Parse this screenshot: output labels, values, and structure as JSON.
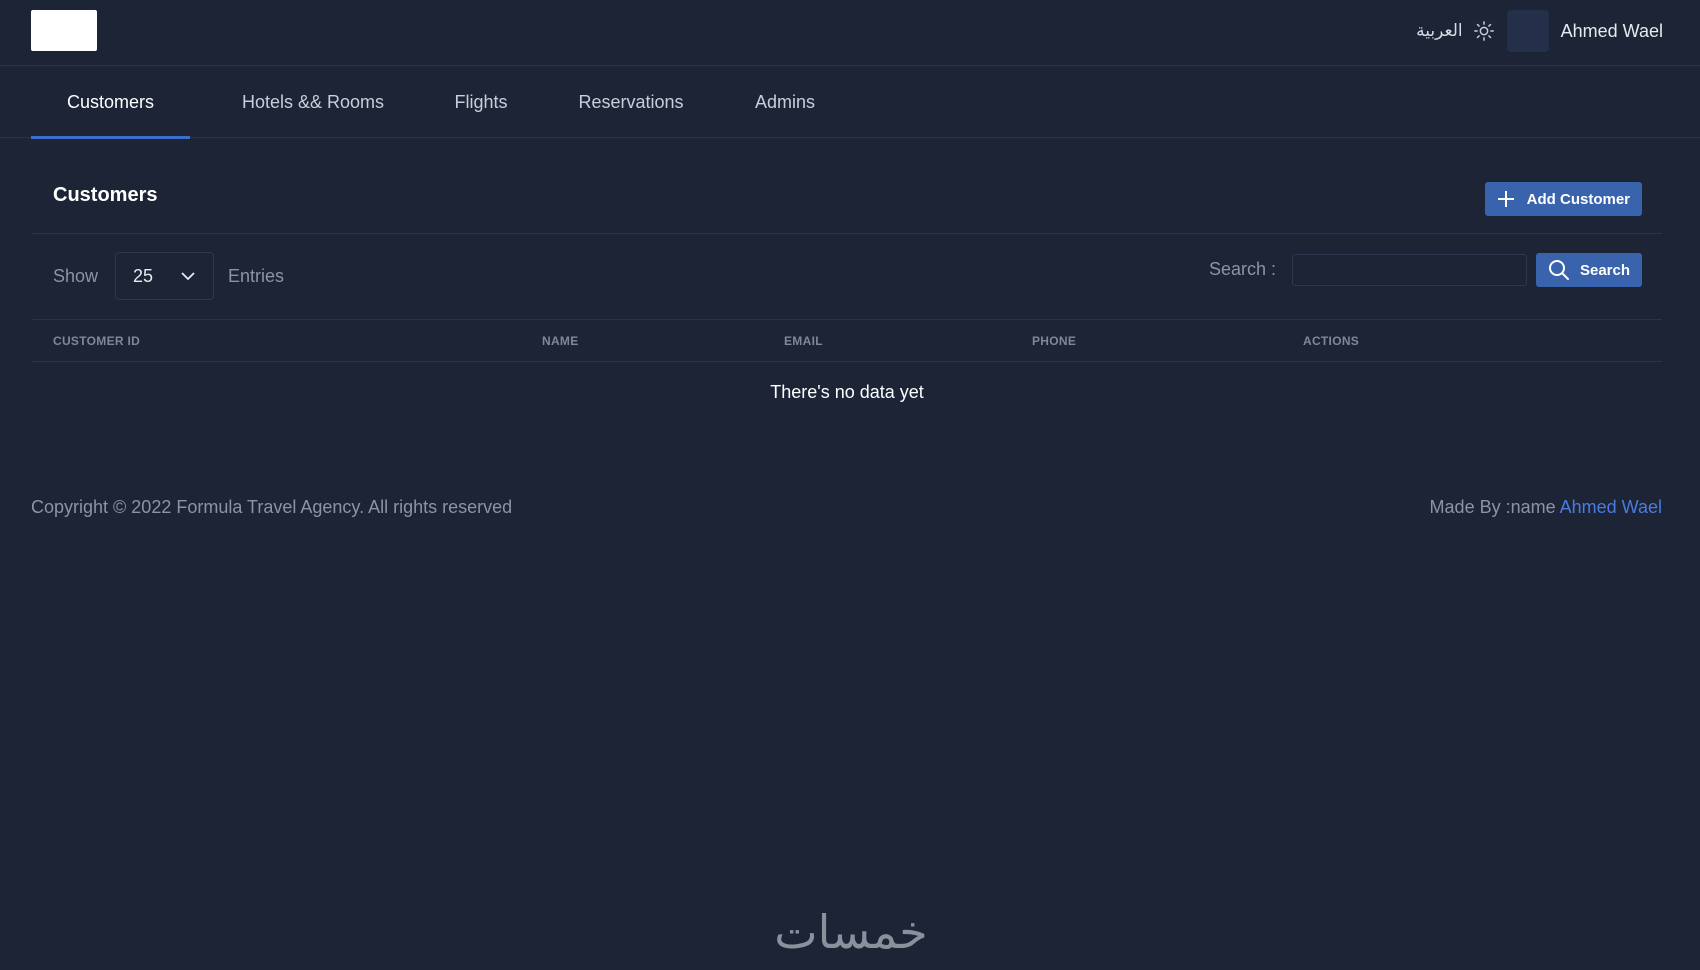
{
  "header": {
    "language_link": "العربية",
    "theme_icon": "sun-icon",
    "user_name": "Ahmed Wael"
  },
  "tabs": [
    {
      "label": "Customers",
      "active": true
    },
    {
      "label": "Hotels && Rooms",
      "active": false
    },
    {
      "label": "Flights",
      "active": false
    },
    {
      "label": "Reservations",
      "active": false
    },
    {
      "label": "Admins",
      "active": false
    }
  ],
  "panel": {
    "title": "Customers",
    "add_button_label": "Add Customer",
    "add_button_icon": "plus-icon",
    "show_label": "Show",
    "entries_value": "25",
    "entries_label": "Entries",
    "search_label": "Search :",
    "search_value": "",
    "search_button_label": "Search",
    "search_button_icon": "search-icon"
  },
  "table": {
    "columns": [
      "CUSTOMER ID",
      "NAME",
      "EMAIL",
      "PHONE",
      "ACTIONS"
    ],
    "rows": [],
    "empty_message": "There's no data yet"
  },
  "footer": {
    "copyright": "Copyright © 2022 Formula Travel Agency. All rights reserved",
    "made_by": "Made By :name",
    "author": "Ahmed Wael"
  },
  "watermark": {
    "text": "خمسات"
  },
  "colors": {
    "background": "#1c2436",
    "accent": "#3a63ad",
    "link": "#4a7be0",
    "border": "#2a3449"
  }
}
